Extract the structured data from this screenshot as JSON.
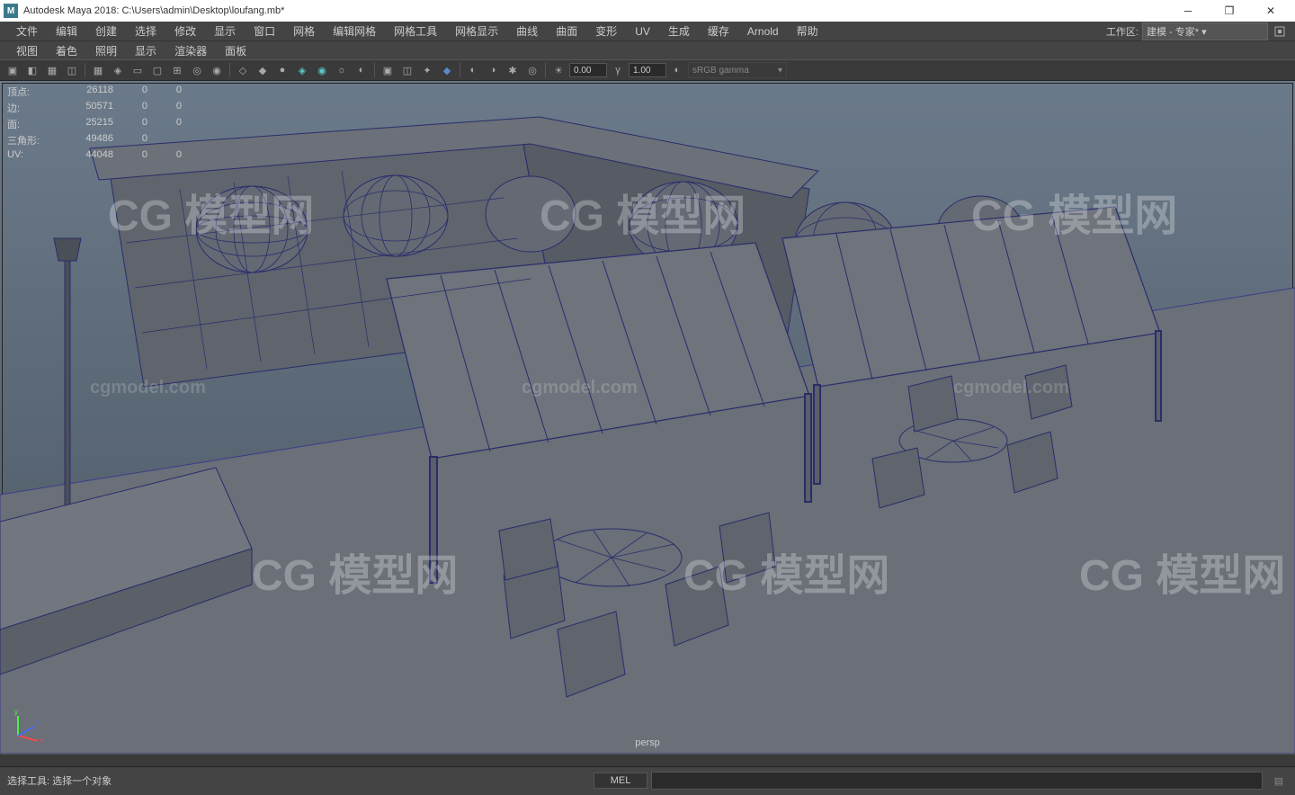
{
  "titlebar": {
    "icon_text": "M",
    "title": "Autodesk Maya 2018: C:\\Users\\admin\\Desktop\\loufang.mb*"
  },
  "menubar": {
    "items": [
      "文件",
      "编辑",
      "创建",
      "选择",
      "修改",
      "显示",
      "窗口",
      "网格",
      "编辑网格",
      "网格工具",
      "网格显示",
      "曲线",
      "曲面",
      "变形",
      "UV",
      "生成",
      "缓存",
      "Arnold",
      "帮助"
    ],
    "workspace_label": "工作区:",
    "workspace_value": "建模 - 专家*"
  },
  "panel_menu": {
    "items": [
      "视图",
      "着色",
      "照明",
      "显示",
      "渲染器",
      "面板"
    ]
  },
  "toolbar": {
    "exposure_val": "0.00",
    "gamma_val": "1.00",
    "colorspace": "sRGB gamma"
  },
  "stats": {
    "rows": [
      {
        "label": "顶点:",
        "v1": "26118",
        "v2": "0",
        "v3": "0"
      },
      {
        "label": "边:",
        "v1": "50571",
        "v2": "0",
        "v3": "0"
      },
      {
        "label": "面:",
        "v1": "25215",
        "v2": "0",
        "v3": "0"
      },
      {
        "label": "三角形:",
        "v1": "49486",
        "v2": "0",
        "v3": ""
      },
      {
        "label": "UV:",
        "v1": "44048",
        "v2": "0",
        "v3": "0"
      }
    ]
  },
  "viewport": {
    "camera": "persp"
  },
  "watermarks": {
    "main": "CG 模型网",
    "sub": "cgmodel.com"
  },
  "statusbar": {
    "message": "选择工具: 选择一个对象",
    "script_lang": "MEL"
  }
}
